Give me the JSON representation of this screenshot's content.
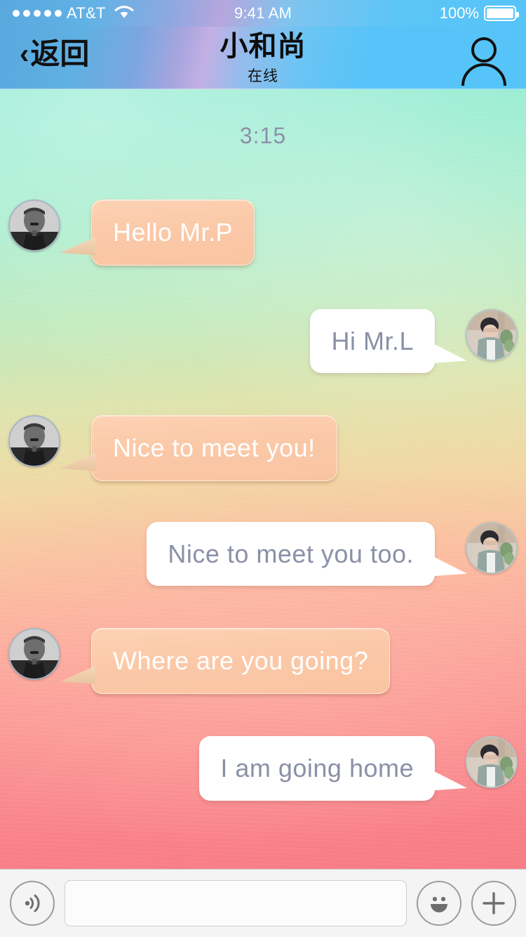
{
  "status_bar": {
    "signal_dots": 5,
    "carrier": "AT&T",
    "wifi_icon": "wifi-icon",
    "time": "9:41 AM",
    "battery_percent": "100%",
    "battery_level": 100
  },
  "nav": {
    "back_chevron": "‹",
    "back_label": "返回",
    "title": "小和尚",
    "subtitle": "在线",
    "profile_icon": "person-icon"
  },
  "chat": {
    "timestamp": "3:15",
    "messages": [
      {
        "side": "them",
        "text": "Hello Mr.P",
        "avatar": "avatar-mr-l"
      },
      {
        "side": "me",
        "text": "Hi Mr.L",
        "avatar": "avatar-mr-p"
      },
      {
        "side": "them",
        "text": "Nice to meet you!",
        "avatar": "avatar-mr-l"
      },
      {
        "side": "me",
        "text": "Nice to meet you too.",
        "avatar": "avatar-mr-p"
      },
      {
        "side": "them",
        "text": "Where are you going?",
        "avatar": "avatar-mr-l"
      },
      {
        "side": "me",
        "text": "I am going home",
        "avatar": "avatar-mr-p"
      }
    ]
  },
  "toolbar": {
    "voice_icon": "voice-wave-icon",
    "input_value": "",
    "input_placeholder": "",
    "emoji_icon": "smiley-icon",
    "add_icon": "plus-icon"
  },
  "colors": {
    "navbar_blue": "#55c4f8",
    "bubble_them": "#fbc9a8",
    "bubble_me": "#ffffff",
    "bubble_me_text": "#8b90a8",
    "timestamp_text": "#8f8fa8",
    "bg_top": "#92ecd2",
    "bg_bottom": "#f87b83",
    "toolbar_bg": "#f4f4f4"
  }
}
